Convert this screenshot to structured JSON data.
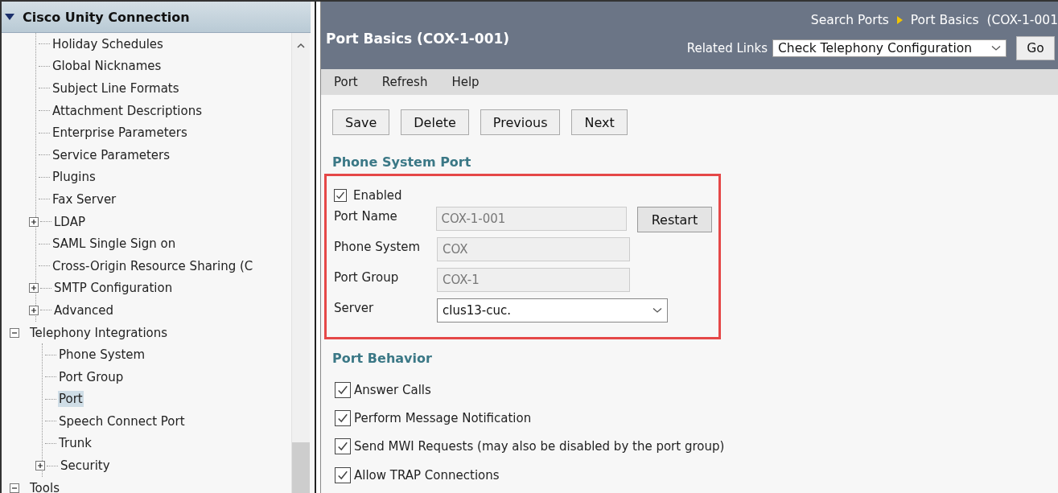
{
  "sidebar": {
    "title": "Cisco Unity Connection",
    "expanded": true,
    "items": [
      {
        "children": [
          {
            "label": "Holiday Schedules",
            "selected": false
          },
          {
            "label": "Global Nicknames",
            "selected": false
          },
          {
            "label": "Subject Line Formats",
            "selected": false
          },
          {
            "label": "Attachment Descriptions",
            "selected": false
          },
          {
            "label": "Enterprise Parameters",
            "selected": false
          },
          {
            "label": "Service Parameters",
            "selected": false
          },
          {
            "label": "Plugins",
            "selected": false
          },
          {
            "label": "Fax Server",
            "selected": false
          },
          {
            "label": "LDAP",
            "selected": false,
            "expanded": false
          },
          {
            "label": "SAML Single Sign on",
            "selected": false
          },
          {
            "label": "Cross-Origin Resource Sharing (C",
            "selected": false
          },
          {
            "label": "SMTP Configuration",
            "selected": false,
            "expanded": false
          },
          {
            "label": "Advanced",
            "selected": false,
            "expanded": false
          }
        ]
      },
      {
        "label": "Telephony Integrations",
        "selected": false,
        "expanded": true,
        "children": [
          {
            "label": "Phone System",
            "selected": false
          },
          {
            "label": "Port Group",
            "selected": false
          },
          {
            "label": "Port",
            "selected": true
          },
          {
            "label": "Speech Connect Port",
            "selected": false
          },
          {
            "label": "Trunk",
            "selected": false
          },
          {
            "label": "Security",
            "selected": false,
            "expanded": false
          }
        ]
      },
      {
        "label": "Tools",
        "selected": false,
        "expanded": true
      }
    ]
  },
  "header": {
    "title": "Port Basics  (COX-1-001)",
    "breadcrumb": [
      "Search Ports",
      "Port Basics  (COX-1-001"
    ],
    "related_links": {
      "label": "Related Links",
      "value": "Check Telephony Configuration"
    },
    "go_button": {
      "label": "Go"
    }
  },
  "menu": [
    "Port",
    "Refresh",
    "Help"
  ],
  "buttons": [
    {
      "label": "Save"
    },
    {
      "label": "Delete"
    },
    {
      "label": "Previous"
    },
    {
      "label": "Next"
    }
  ],
  "phone_system_port": {
    "title": "Phone System Port",
    "highlighted": true,
    "enabled": {
      "label": "Enabled",
      "checked": true
    },
    "fields": [
      {
        "kind": "text",
        "label": "Port Name",
        "value": "COX-1-001",
        "disabled": true,
        "button": {
          "label": "Restart"
        }
      },
      {
        "kind": "text",
        "label": "Phone System",
        "value": "COX",
        "disabled": true
      },
      {
        "kind": "text",
        "label": "Port Group",
        "value": "COX-1",
        "disabled": true
      },
      {
        "kind": "select",
        "label": "Server",
        "value": "clus13-cuc."
      }
    ]
  },
  "port_behavior": {
    "title": "Port Behavior",
    "options": [
      {
        "label": "Answer Calls",
        "checked": true
      },
      {
        "label": "Perform Message Notification",
        "checked": true
      },
      {
        "label": "Send MWI Requests (may also be disabled by the port group)",
        "checked": true
      },
      {
        "label": "Allow TRAP Connections",
        "checked": true
      }
    ]
  }
}
